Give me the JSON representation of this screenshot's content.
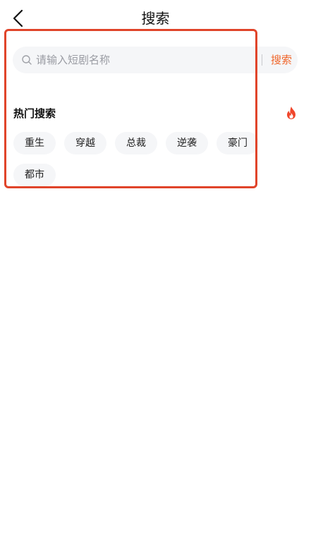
{
  "header": {
    "title": "搜索",
    "back_icon": "chevron-left-icon"
  },
  "search": {
    "placeholder": "请输入短剧名称",
    "value": "",
    "submit_label": "搜索",
    "icon": "search-icon"
  },
  "hot_search": {
    "title": "热门搜索",
    "icon": "fire-icon",
    "tags": [
      "重生",
      "穿越",
      "总裁",
      "逆袭",
      "豪门",
      "都市"
    ]
  },
  "colors": {
    "accent": "#f0662b",
    "highlight_border": "#e0442a",
    "chip_background": "#f5f6f8"
  }
}
